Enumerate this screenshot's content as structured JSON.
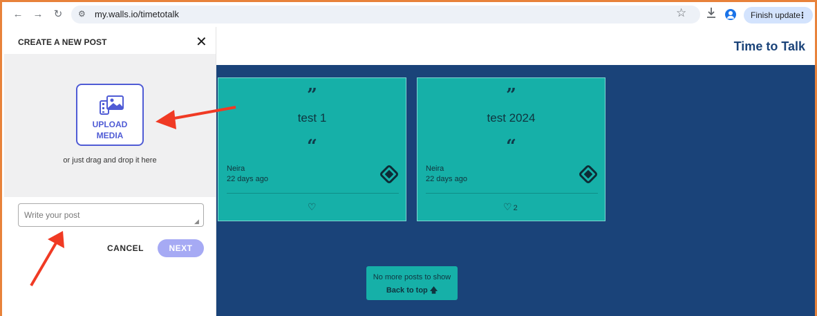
{
  "browser": {
    "url": "my.walls.io/timetotalk",
    "finish_update": "Finish update"
  },
  "create_post": {
    "title": "CREATE A NEW POST",
    "upload_label_line1": "UPLOAD",
    "upload_label_line2": "MEDIA",
    "drag_hint": "or just drag and drop it here",
    "input_placeholder": "Write your post",
    "cancel_label": "CANCEL",
    "next_label": "NEXT"
  },
  "wall": {
    "title": "Time to Talk",
    "posts": [
      {
        "text": "test 1",
        "author": "Neira",
        "time": "22 days ago",
        "likes": ""
      },
      {
        "text": "test 2024",
        "author": "Neira",
        "time": "22 days ago",
        "likes": "2"
      }
    ],
    "no_more": "No more posts to show",
    "back_to_top": "Back to top"
  },
  "colors": {
    "wall_bg": "#1a4379",
    "card_bg": "#16b0a8",
    "accent": "#4f5bd5",
    "annotation_arrow": "#f03a24",
    "frame_border": "#e8823a"
  }
}
